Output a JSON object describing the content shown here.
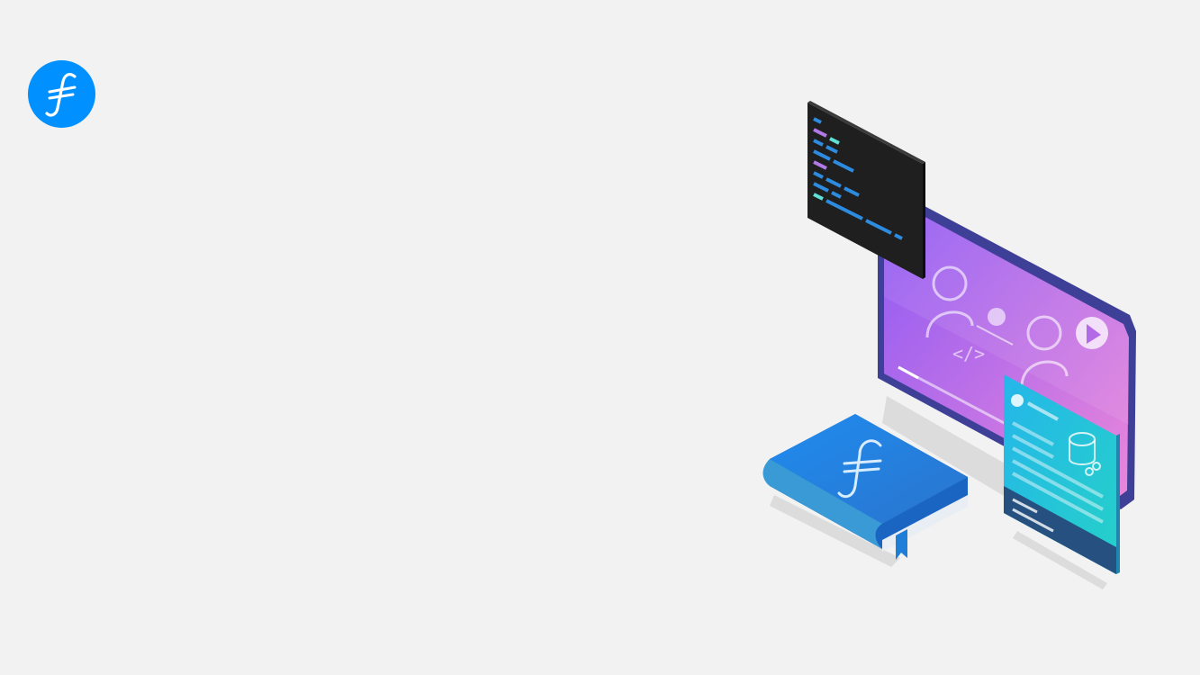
{
  "brand": {
    "logo_icon": "filecoin-logo-icon",
    "accent_color": "#0090ff"
  },
  "illustration": {
    "icons": [
      "code-terminal-icon",
      "video-player-icon",
      "book-icon",
      "database-card-icon",
      "user-icon",
      "play-icon"
    ],
    "colors": {
      "terminal": "#1f1f1f",
      "video_frame": "#3e3f96",
      "video_gradient_start": "#8f5bf2",
      "video_gradient_end": "#e27fdc",
      "book": "#1d7fe0",
      "card": "#1fb8d6",
      "card_footer": "#25507f"
    }
  }
}
